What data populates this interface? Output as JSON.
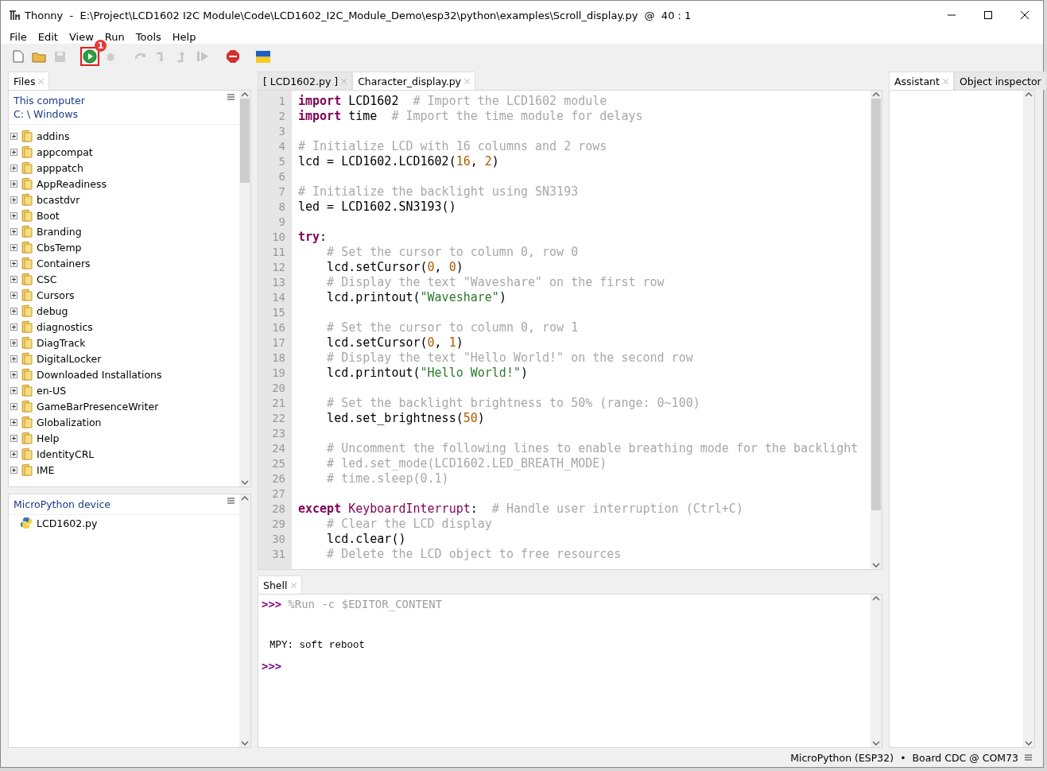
{
  "window": {
    "title": "Thonny  -  E:\\Project\\LCD1602 I2C Module\\Code\\LCD1602_I2C_Module_Demo\\esp32\\python\\examples\\Scroll_display.py  @  40 : 1"
  },
  "menu": [
    "File",
    "Edit",
    "View",
    "Run",
    "Tools",
    "Help"
  ],
  "toolbar": [
    {
      "kind": "new",
      "disabled": false,
      "highlighted": false
    },
    {
      "kind": "open",
      "disabled": false,
      "highlighted": false
    },
    {
      "kind": "save",
      "disabled": true,
      "highlighted": false
    },
    {
      "kind": "run",
      "disabled": false,
      "highlighted": true,
      "badge": "1"
    },
    {
      "kind": "debug",
      "disabled": true,
      "highlighted": false
    },
    {
      "kind": "step_over",
      "disabled": true,
      "highlighted": false
    },
    {
      "kind": "step_into",
      "disabled": true,
      "highlighted": false
    },
    {
      "kind": "step_out",
      "disabled": true,
      "highlighted": false
    },
    {
      "kind": "resume",
      "disabled": true,
      "highlighted": false
    },
    {
      "kind": "stop",
      "disabled": false,
      "highlighted": false
    },
    {
      "kind": "flag",
      "disabled": false,
      "highlighted": false
    }
  ],
  "files_pane": {
    "tabs": [
      {
        "label": "Files",
        "selected": true,
        "closable": true
      }
    ],
    "location": [
      "This computer",
      "C: \\ Windows"
    ],
    "items": [
      "addins",
      "appcompat",
      "apppatch",
      "AppReadiness",
      "bcastdvr",
      "Boot",
      "Branding",
      "CbsTemp",
      "Containers",
      "CSC",
      "Cursors",
      "debug",
      "diagnostics",
      "DiagTrack",
      "DigitalLocker",
      "Downloaded Installations",
      "en-US",
      "GameBarPresenceWriter",
      "Globalization",
      "Help",
      "IdentityCRL",
      "IME"
    ],
    "device": {
      "title": "MicroPython device",
      "files": [
        "LCD1602.py"
      ]
    }
  },
  "editor": {
    "tabs": [
      {
        "label": "[ LCD1602.py ]",
        "selected": false,
        "closable": true
      },
      {
        "label": "Character_display.py",
        "selected": true,
        "closable": true
      }
    ],
    "lines": [
      {
        "number": "1",
        "tokens": [
          {
            "kind": "keyword",
            "text": "import"
          },
          {
            "kind": "plain",
            "text": " LCD1602  "
          },
          {
            "kind": "comment",
            "text": "# Import the LCD1602 module"
          }
        ]
      },
      {
        "number": "2",
        "tokens": [
          {
            "kind": "keyword",
            "text": "import"
          },
          {
            "kind": "plain",
            "text": " time  "
          },
          {
            "kind": "comment",
            "text": "# Import the time module for delays"
          }
        ]
      },
      {
        "number": "3"
      },
      {
        "number": "4",
        "tokens": [
          {
            "kind": "comment",
            "text": "# Initialize LCD with 16 columns and 2 rows"
          }
        ]
      },
      {
        "number": "5",
        "tokens": [
          {
            "kind": "plain",
            "text": "lcd = LCD1602.LCD1602("
          },
          {
            "kind": "number",
            "text": "16"
          },
          {
            "kind": "plain",
            "text": ", "
          },
          {
            "kind": "number",
            "text": "2"
          },
          {
            "kind": "plain",
            "text": ")"
          }
        ]
      },
      {
        "number": "6"
      },
      {
        "number": "7",
        "tokens": [
          {
            "kind": "comment",
            "text": "# Initialize the backlight using SN3193"
          }
        ]
      },
      {
        "number": "8",
        "tokens": [
          {
            "kind": "plain",
            "text": "led = LCD1602.SN3193()"
          }
        ]
      },
      {
        "number": "9"
      },
      {
        "number": "10",
        "tokens": [
          {
            "kind": "keyword",
            "text": "try"
          },
          {
            "kind": "plain",
            "text": ":"
          }
        ]
      },
      {
        "number": "11",
        "tokens": [
          {
            "kind": "comment",
            "text": "    # Set the cursor to column 0, row 0"
          }
        ]
      },
      {
        "number": "12",
        "tokens": [
          {
            "kind": "plain",
            "text": "    lcd.setCursor("
          },
          {
            "kind": "number",
            "text": "0"
          },
          {
            "kind": "plain",
            "text": ", "
          },
          {
            "kind": "number",
            "text": "0"
          },
          {
            "kind": "plain",
            "text": ")"
          }
        ]
      },
      {
        "number": "13",
        "tokens": [
          {
            "kind": "comment",
            "text": "    # Display the text \"Waveshare\" on the first row"
          }
        ]
      },
      {
        "number": "14",
        "tokens": [
          {
            "kind": "plain",
            "text": "    lcd.printout("
          },
          {
            "kind": "string",
            "text": "\"Waveshare\""
          },
          {
            "kind": "plain",
            "text": ")"
          }
        ]
      },
      {
        "number": "15"
      },
      {
        "number": "16",
        "tokens": [
          {
            "kind": "comment",
            "text": "    # Set the cursor to column 0, row 1"
          }
        ]
      },
      {
        "number": "17",
        "tokens": [
          {
            "kind": "plain",
            "text": "    lcd.setCursor("
          },
          {
            "kind": "number",
            "text": "0"
          },
          {
            "kind": "plain",
            "text": ", "
          },
          {
            "kind": "number",
            "text": "1"
          },
          {
            "kind": "plain",
            "text": ")"
          }
        ]
      },
      {
        "number": "18",
        "tokens": [
          {
            "kind": "comment",
            "text": "    # Display the text \"Hello World!\" on the second row"
          }
        ]
      },
      {
        "number": "19",
        "tokens": [
          {
            "kind": "plain",
            "text": "    lcd.printout("
          },
          {
            "kind": "string",
            "text": "\"Hello World!\""
          },
          {
            "kind": "plain",
            "text": ")"
          }
        ]
      },
      {
        "number": "20"
      },
      {
        "number": "21",
        "tokens": [
          {
            "kind": "comment",
            "text": "    # Set the backlight brightness to 50% (range: 0~100)"
          }
        ]
      },
      {
        "number": "22",
        "tokens": [
          {
            "kind": "plain",
            "text": "    led.set_brightness("
          },
          {
            "kind": "number",
            "text": "50"
          },
          {
            "kind": "plain",
            "text": ")"
          }
        ]
      },
      {
        "number": "23"
      },
      {
        "number": "24",
        "tokens": [
          {
            "kind": "comment",
            "text": "    # Uncomment the following lines to enable breathing mode for the backlight"
          }
        ]
      },
      {
        "number": "25",
        "tokens": [
          {
            "kind": "comment",
            "text": "    # led.set_mode(LCD1602.LED_BREATH_MODE)"
          }
        ]
      },
      {
        "number": "26",
        "tokens": [
          {
            "kind": "comment",
            "text": "    # time.sleep(0.1)"
          }
        ]
      },
      {
        "number": "27"
      },
      {
        "number": "28",
        "tokens": [
          {
            "kind": "keyword",
            "text": "except"
          },
          {
            "kind": "builtin",
            "text": " KeyboardInterrupt"
          },
          {
            "kind": "plain",
            "text": ":  "
          },
          {
            "kind": "comment",
            "text": "# Handle user interruption (Ctrl+C)"
          }
        ]
      },
      {
        "number": "29",
        "tokens": [
          {
            "kind": "comment",
            "text": "    # Clear the LCD display"
          }
        ]
      },
      {
        "number": "30",
        "tokens": [
          {
            "kind": "plain",
            "text": "    lcd.clear()"
          }
        ]
      },
      {
        "number": "31",
        "tokens": [
          {
            "kind": "comment",
            "text": "    # Delete the LCD object to free resources"
          }
        ]
      }
    ]
  },
  "shell": {
    "tabs": [
      {
        "label": "Shell",
        "selected": true,
        "closable": true
      }
    ],
    "lines": [
      {
        "kind": "command",
        "prompt": ">>>",
        "text": "%Run -c $EDITOR_CONTENT"
      },
      {
        "kind": "blank"
      },
      {
        "kind": "output",
        "text": "MPY: soft reboot"
      },
      {
        "kind": "prompt",
        "prompt": ">>>"
      }
    ]
  },
  "side_pane": {
    "tabs": [
      {
        "label": "Assistant",
        "selected": true,
        "closable": true
      },
      {
        "label": "Object inspector",
        "selected": false,
        "closable": false
      }
    ]
  },
  "status_bar": {
    "interpreter": "MicroPython (ESP32)",
    "separator": "•",
    "port": "Board CDC @ COM73"
  }
}
